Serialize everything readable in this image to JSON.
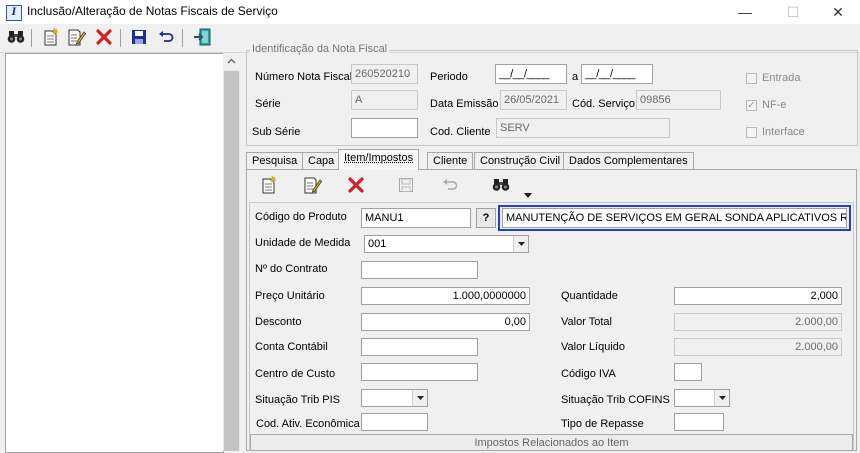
{
  "window": {
    "title": "Inclusão/Alteração de Notas Fiscais de Serviço",
    "icon_letter": "I",
    "minimize_glyph": "—",
    "maximize_glyph": "☐",
    "close_glyph": "✕"
  },
  "header": {
    "group_title": "Identificação da Nota Fiscal",
    "numero_label": "Número Nota Fiscal",
    "numero_value": "260520210",
    "serie_label": "Série",
    "serie_value": "A",
    "subserie_label": "Sub Série",
    "subserie_value": "",
    "periodo_label": "Periodo",
    "periodo_from": "__/__/____",
    "periodo_a": "a",
    "periodo_to": "__/__/____",
    "data_emissao_label": "Data Emissão",
    "data_emissao_value": "26/05/2021",
    "cod_servico_label": "Cód. Serviço",
    "cod_servico_value": "09856",
    "cod_cliente_label": "Cod. Cliente",
    "cod_cliente_value": "SERV",
    "entrada_label": "Entrada",
    "nfe_label": "NF-e",
    "interface_label": "Interface",
    "check_mark": "✓"
  },
  "tabs": [
    "Pesquisa",
    "Capa",
    "Item/Impostos",
    "Cliente",
    "Construção Civil",
    "Dados Complementares"
  ],
  "item": {
    "codigo_produto_label": "Código do Produto",
    "codigo_produto_value": "MANU1",
    "lookup_label": "?",
    "descricao_value": "MANUTENÇÃO DE SERVIÇOS EM GERAL SONDA APLICATIVOS R&D TE",
    "unidade_label": "Unidade de Medida",
    "unidade_value": "001",
    "contrato_label": "Nº do Contrato",
    "contrato_value": "",
    "preco_label": "Preço Unitário",
    "preco_value": "1.000,0000000",
    "quantidade_label": "Quantidade",
    "quantidade_value": "2,000",
    "desconto_label": "Desconto",
    "desconto_value": "0,00",
    "valor_total_label": "Valor Total",
    "valor_total_value": "2.000,00",
    "conta_label": "Conta Contábil",
    "conta_value": "",
    "valor_liquido_label": "Valor Líquido",
    "valor_liquido_value": "2.000,00",
    "centro_label": "Centro de Custo",
    "centro_value": "",
    "codigo_iva_label": "Código IVA",
    "codigo_iva_value": "",
    "pis_label": "Situação Trib PIS",
    "pis_value": "",
    "cofins_label": "Situação Trib COFINS",
    "cofins_value": "",
    "atividade_label": "Cod. Ativ. Econômica",
    "atividade_value": "",
    "repasse_label": "Tipo de Repasse",
    "repasse_value": "",
    "impostos_title": "Impostos Relacionados ao Item"
  },
  "colors": {
    "focus_border": "#1f3fd8",
    "delete_red": "#d42020",
    "save_blue": "#1a2f9a"
  }
}
